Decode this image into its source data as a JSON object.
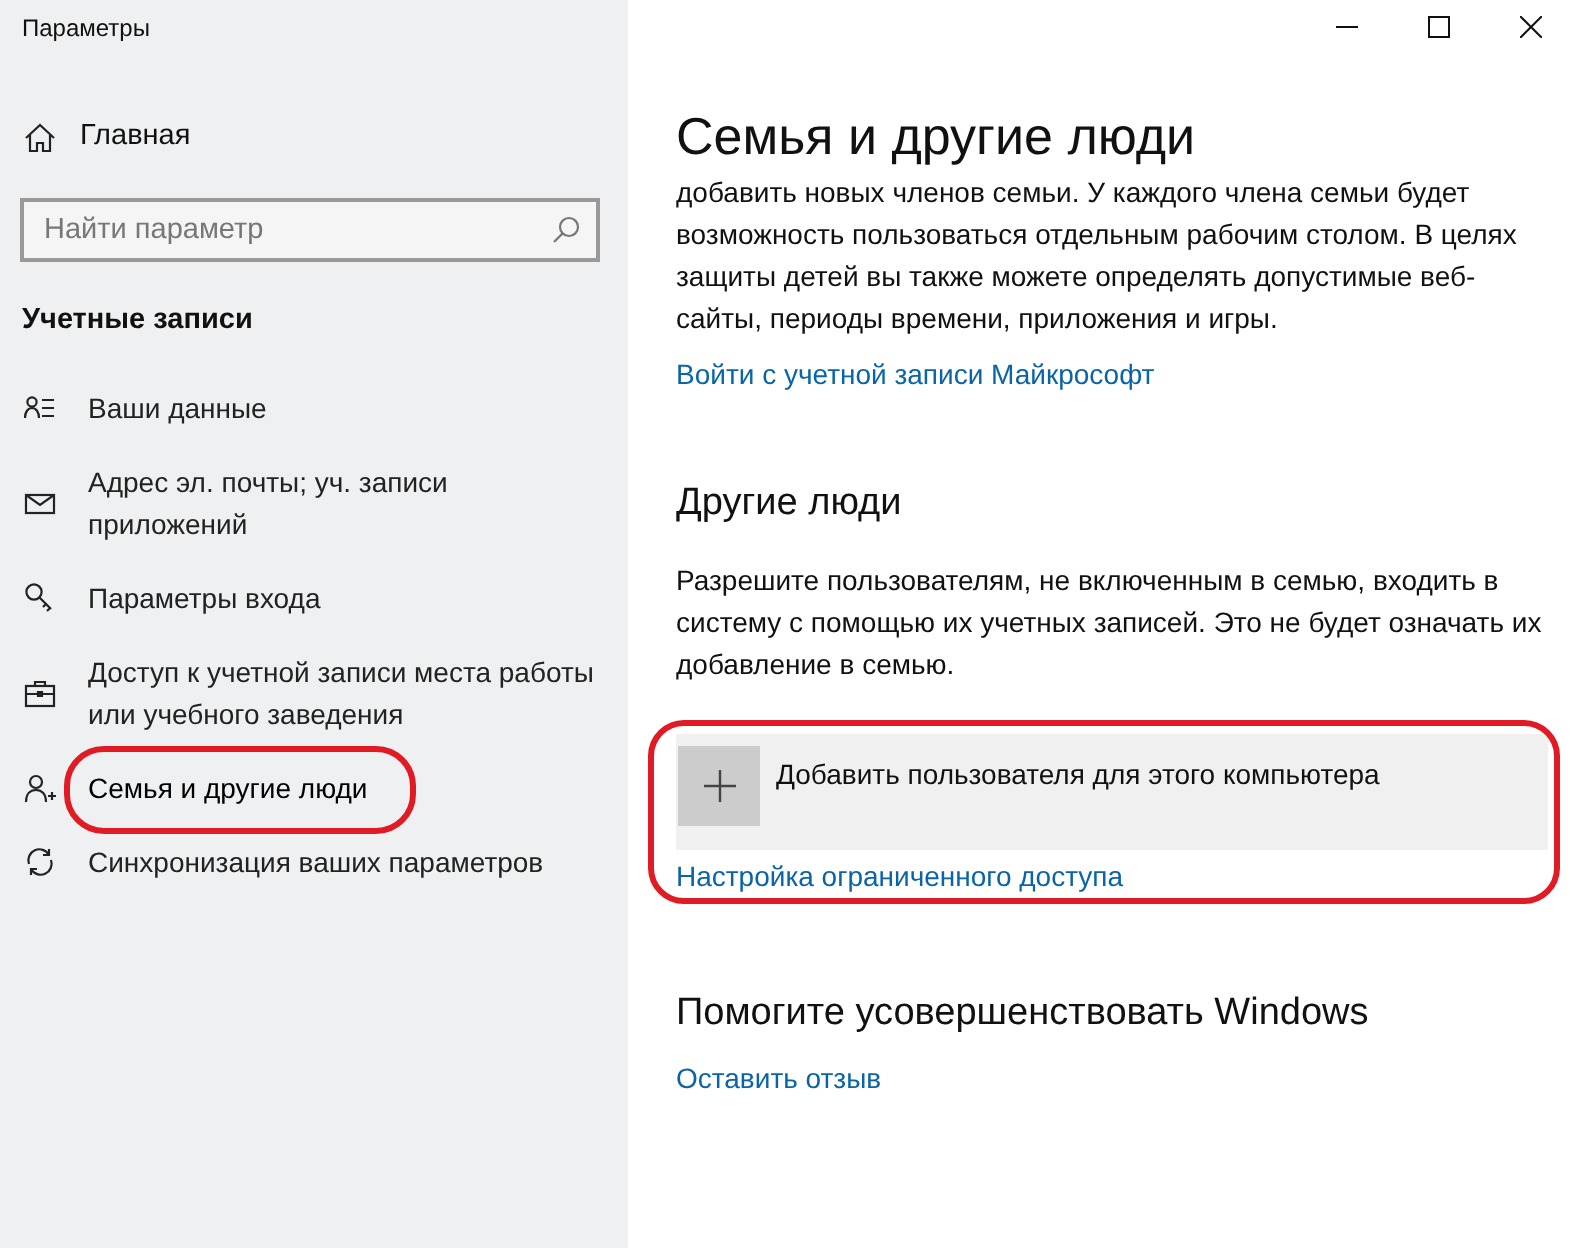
{
  "window": {
    "title": "Параметры"
  },
  "sidebar": {
    "home": "Главная",
    "search": {
      "placeholder": "Найти параметр"
    },
    "section": "Учетные записи",
    "items": [
      {
        "label": "Ваши данные",
        "selected": false,
        "circled": false
      },
      {
        "label": "Адрес эл. почты; уч. записи приложений",
        "selected": false,
        "circled": false
      },
      {
        "label": "Параметры входа",
        "selected": false,
        "circled": false
      },
      {
        "label": "Доступ к учетной записи места работы или учебного заведения",
        "selected": false,
        "circled": false
      },
      {
        "label": "Семья и другие люди",
        "selected": true,
        "circled": true
      },
      {
        "label": "Синхронизация ваших параметров",
        "selected": false,
        "circled": false
      }
    ]
  },
  "content": {
    "title": "Семья и другие люди",
    "intro": "добавить новых членов семьи. У каждого члена семьи будет возможность пользоваться отдельным рабочим столом. В целях защиты детей вы также можете определять допустимые веб-сайты, периоды времени, приложения и игры.",
    "intro_link": "Войти с учетной записи Майкрософт",
    "other_people": {
      "heading": "Другие люди",
      "text": "Разрешите пользователям, не включенным в семью, входить в систему с помощью их учетных записей. Это не будет означать их добавление в семью.",
      "add_button": "Добавить пользователя для этого компьютера",
      "link": "Настройка ограниченного доступа",
      "circled": true
    },
    "improve": {
      "heading": "Помогите усовершенствовать Windows",
      "link": "Оставить отзыв"
    }
  }
}
